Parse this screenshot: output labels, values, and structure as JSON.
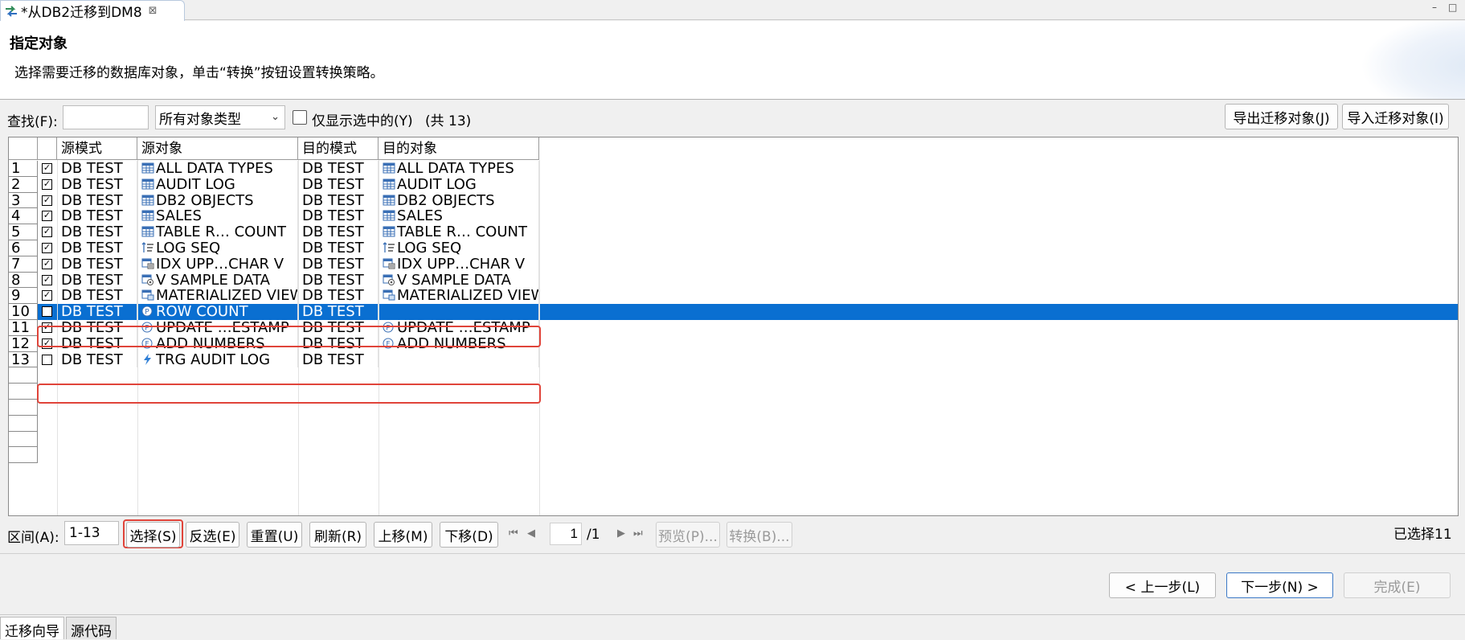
{
  "editor_tab": {
    "title": "*从DB2迁移到DM8",
    "close": "⊠"
  },
  "window_controls": {
    "minimize": "–",
    "maximize": "□"
  },
  "header": {
    "title": "指定对象",
    "description": "选择需要迁移的数据库对象，单击“转换”按钮设置转换策略。"
  },
  "filter": {
    "find_label": "查找(F):",
    "find_value": "",
    "type_select": "所有对象类型",
    "show_selected_label": "仅显示选中的(Y)",
    "total": "(共 13)",
    "export_button": "导出迁移对象(J)",
    "import_button": "导入迁移对象(I)"
  },
  "table": {
    "columns": [
      "源模式",
      "源对象",
      "目的模式",
      "目的对象"
    ],
    "rows": [
      {
        "num": "1",
        "checked": "☑",
        "src_schema": "DB TEST",
        "src_icon": "table-icon",
        "src_obj": "ALL DATA TYPES",
        "dst_schema": "DB TEST",
        "dst_icon": "table-icon",
        "dst_obj": "ALL DATA TYPES"
      },
      {
        "num": "2",
        "checked": "☑",
        "src_schema": "DB TEST",
        "src_icon": "table-icon",
        "src_obj": "AUDIT LOG",
        "dst_schema": "DB TEST",
        "dst_icon": "table-icon",
        "dst_obj": "AUDIT LOG"
      },
      {
        "num": "3",
        "checked": "☑",
        "src_schema": "DB TEST",
        "src_icon": "table-icon",
        "src_obj": "DB2 OBJECTS",
        "dst_schema": "DB TEST",
        "dst_icon": "table-icon",
        "dst_obj": "DB2 OBJECTS"
      },
      {
        "num": "4",
        "checked": "☑",
        "src_schema": "DB TEST",
        "src_icon": "table-icon",
        "src_obj": "SALES",
        "dst_schema": "DB TEST",
        "dst_icon": "table-icon",
        "dst_obj": "SALES"
      },
      {
        "num": "5",
        "checked": "☑",
        "src_schema": "DB TEST",
        "src_icon": "table-icon",
        "src_obj": "TABLE R… COUNT",
        "dst_schema": "DB TEST",
        "dst_icon": "table-icon",
        "dst_obj": "TABLE R… COUNT"
      },
      {
        "num": "6",
        "checked": "☑",
        "src_schema": "DB TEST",
        "src_icon": "sequence-icon",
        "src_obj": "LOG SEQ",
        "dst_schema": "DB TEST",
        "dst_icon": "sequence-icon",
        "dst_obj": "LOG SEQ"
      },
      {
        "num": "7",
        "checked": "☑",
        "src_schema": "DB TEST",
        "src_icon": "index-icon",
        "src_obj": "IDX UPP…CHAR V",
        "dst_schema": "DB TEST",
        "dst_icon": "index-icon",
        "dst_obj": "IDX UPP…CHAR V"
      },
      {
        "num": "8",
        "checked": "☑",
        "src_schema": "DB TEST",
        "src_icon": "view-icon",
        "src_obj": "V SAMPLE DATA",
        "dst_schema": "DB TEST",
        "dst_icon": "view-icon",
        "dst_obj": "V SAMPLE DATA"
      },
      {
        "num": "9",
        "checked": "☑",
        "src_schema": "DB TEST",
        "src_icon": "mview-icon",
        "src_obj": "MATERIALIZED VIEW",
        "dst_schema": "DB TEST",
        "dst_icon": "mview-icon",
        "dst_obj": "MATERIALIZED VIEW"
      },
      {
        "num": "10",
        "checked": "☐",
        "src_schema": "DB TEST",
        "src_icon": "procedure-icon",
        "src_obj": "ROW COUNT",
        "dst_schema": "DB TEST",
        "dst_icon": "",
        "dst_obj": ""
      },
      {
        "num": "11",
        "checked": "☑",
        "src_schema": "DB TEST",
        "src_icon": "procedure-icon",
        "src_obj": "UPDATE …ESTAMP",
        "dst_schema": "DB TEST",
        "dst_icon": "procedure-icon",
        "dst_obj": "UPDATE …ESTAMP"
      },
      {
        "num": "12",
        "checked": "☑",
        "src_schema": "DB TEST",
        "src_icon": "function-icon",
        "src_obj": "ADD NUMBERS",
        "dst_schema": "DB TEST",
        "dst_icon": "function-icon",
        "dst_obj": "ADD NUMBERS"
      },
      {
        "num": "13",
        "checked": "☐",
        "src_schema": "DB TEST",
        "src_icon": "trigger-icon",
        "src_obj": "TRG AUDIT LOG",
        "dst_schema": "DB TEST",
        "dst_icon": "",
        "dst_obj": ""
      }
    ],
    "selected_row": "10",
    "highlight_color": "#0a6fd1",
    "annotation_color": "#e0443a"
  },
  "bottom": {
    "range_label": "区间(A):",
    "range_value": "1-13",
    "select_button": "选择(S)",
    "invert_button": "反选(E)",
    "reset_button": "重置(U)",
    "refresh_button": "刷新(R)",
    "up_button": "上移(M)",
    "down_button": "下移(D)",
    "page_value": "1",
    "page_total": "/1",
    "preview_button": "预览(P)...",
    "convert_button": "转换(B)...",
    "selected_count": "已选择11"
  },
  "wizard": {
    "back_button": "< 上一步(L)",
    "next_button": "下一步(N) >",
    "finish_button": "完成(E)"
  },
  "view_tabs": [
    "迁移向导",
    "源代码"
  ]
}
